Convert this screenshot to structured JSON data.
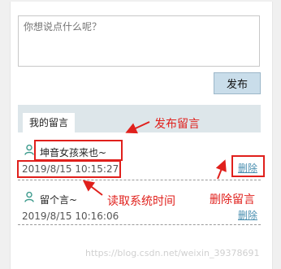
{
  "compose": {
    "placeholder": "你想说点什么呢？",
    "publish_label": "发布"
  },
  "list": {
    "tab_label": "我的留言"
  },
  "messages": [
    {
      "text": "坤音女孩来也~",
      "time": "2019/8/15 10:15:27",
      "delete_label": "删除"
    },
    {
      "text": "留个言~",
      "time": "2019/8/15 10:16:06",
      "delete_label": "删除"
    }
  ],
  "annotations": {
    "publish": "发布留言",
    "read_time": "读取系统时间",
    "delete": "删除留言"
  },
  "watermark": "https://blog.csdn.net/weixin_39378691",
  "colors": {
    "highlight": "#e0201c",
    "link": "#4a8fb0",
    "button": "#c9ddea"
  }
}
